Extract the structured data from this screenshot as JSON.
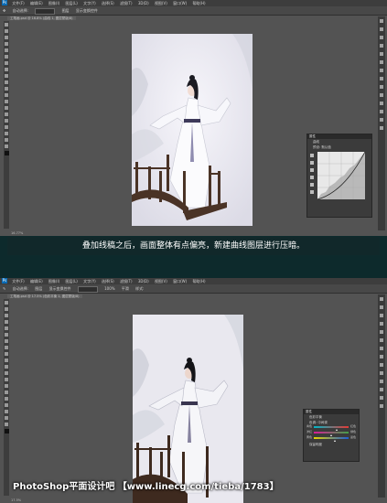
{
  "top_window": {
    "menu": [
      "文件(F)",
      "编辑(E)",
      "图像(I)",
      "图层(L)",
      "文字(Y)",
      "选择(S)",
      "滤镜(T)",
      "3D(D)",
      "视图(V)",
      "窗口(W)",
      "帮助(H)"
    ],
    "options": [
      "自动选择:",
      "图层",
      "显示变换控件"
    ],
    "doc_tab": "工笔画.psd @ 16.8% (曲线 1, 图层蒙版/8)",
    "panel_title": "属性",
    "panel_subtitle": "曲线",
    "preset_label": "预设:",
    "preset_value": "默认值",
    "status": "16.77%"
  },
  "caption": "叠加线稿之后，画面整体有点偏亮，新建曲线图层进行压暗。",
  "bottom_window": {
    "menu": [
      "文件(F)",
      "编辑(E)",
      "图像(I)",
      "图层(L)",
      "文字(Y)",
      "选择(S)",
      "滤镜(T)",
      "3D(D)",
      "视图(V)",
      "窗口(W)",
      "帮助(H)"
    ],
    "options": [
      "自动选择:",
      "图层",
      "显示变换控件",
      "100%",
      "平滑",
      "样式:"
    ],
    "doc_tab": "工笔画.psd @ 17.5% (色彩平衡 1, 图层蒙版/8)",
    "panel_title": "属性",
    "panel_subtitle": "色彩平衡",
    "tone_label": "色调:",
    "tone_value": "中间调",
    "sliders": [
      {
        "left": "青色",
        "right": "红色",
        "value": 0.62
      },
      {
        "left": "洋红",
        "right": "绿色",
        "value": 0.48
      },
      {
        "left": "黄色",
        "right": "蓝色",
        "value": 0.58
      }
    ],
    "preserve": "保留明度",
    "status": "17.5%"
  },
  "watermark": "PhotoShop平面设计吧 【www.linecg.com/tieba/1783】",
  "colors": {
    "background": "#0d2a2c",
    "workspace": "#535353",
    "caption_bg": "#12282a"
  }
}
